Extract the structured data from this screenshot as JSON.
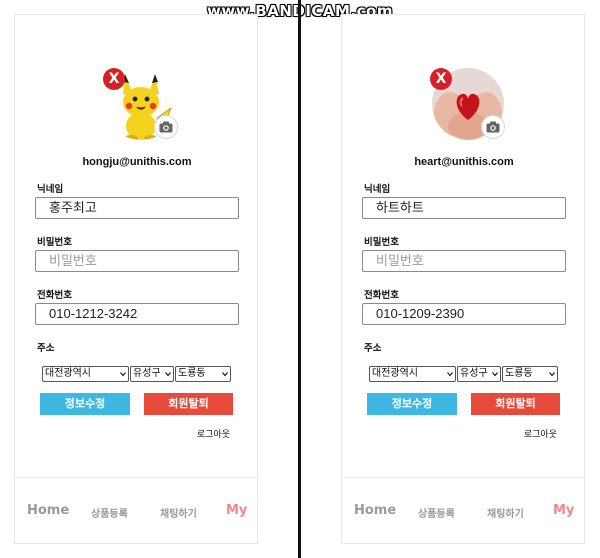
{
  "watermark": "www.BANDICAM.com",
  "colors": {
    "accent_blue": "#3fb7e3",
    "accent_red": "#e64a3a",
    "active_nav": "#f4878d",
    "delete_red": "#d81f26"
  },
  "icons": {
    "delete": "close-x-icon",
    "camera": "camera-icon",
    "dropdown": "chevron-down-icon"
  },
  "screens": [
    {
      "avatar": "pikachu-image",
      "delete_glyph": "X",
      "email": "hongju@unithis.com",
      "nickname": {
        "label": "닉네임",
        "value": "홍주최고"
      },
      "password": {
        "label": "비밀번호",
        "placeholder": "비밀번호"
      },
      "phone": {
        "label": "전화번호",
        "value": "010-1212-3242"
      },
      "address": {
        "label": "주소",
        "city": "대전광역시",
        "district": "유성구",
        "dong": "도룡동"
      },
      "edit_button": "정보수정",
      "withdraw_button": "회원탈퇴",
      "logout": "로그아웃",
      "nav": {
        "home": "Home",
        "product": "상품등록",
        "chat": "채팅하기",
        "my": "My"
      }
    },
    {
      "avatar": "heart-in-hands-image",
      "delete_glyph": "X",
      "email": "heart@unithis.com",
      "nickname": {
        "label": "닉네임",
        "value": "하트하트"
      },
      "password": {
        "label": "비밀번호",
        "placeholder": "비밀번호"
      },
      "phone": {
        "label": "전화번호",
        "value": "010-1209-2390"
      },
      "address": {
        "label": "주소",
        "city": "대전광역시",
        "district": "유성구",
        "dong": "도룡동"
      },
      "edit_button": "정보수정",
      "withdraw_button": "회원탈퇴",
      "logout": "로그아웃",
      "nav": {
        "home": "Home",
        "product": "상품등록",
        "chat": "채팅하기",
        "my": "My"
      }
    }
  ]
}
